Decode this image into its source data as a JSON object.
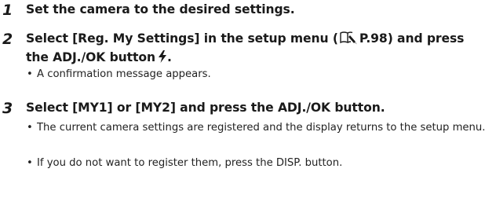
{
  "steps": [
    {
      "number": "1",
      "text": "Set the camera to the desired settings."
    },
    {
      "number": "2",
      "text_before_ref": "Select [Reg. My Settings] in the setup menu (",
      "ref_page": "P.98",
      "text_after_ref": ") and press the ADJ./OK button",
      "icon": "flash-icon",
      "bullets": [
        "A confirmation message appears."
      ]
    },
    {
      "number": "3",
      "text": "Select [MY1] or [MY2] and press the ADJ./OK button.",
      "bullets": [
        "The current camera settings are registered and the display returns to the setup menu.",
        "If you do not want to register them, press the DISP. button."
      ]
    }
  ],
  "bullet_symbol": "•",
  "icons": {
    "reference": "book-reference-icon",
    "flash": "flash-icon"
  }
}
